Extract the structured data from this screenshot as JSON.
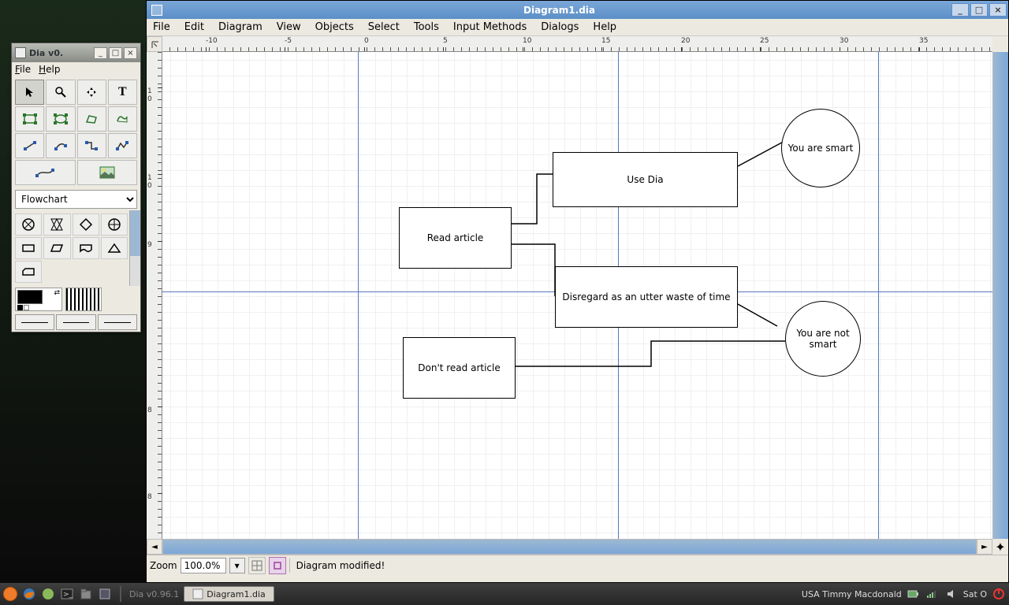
{
  "toolbox": {
    "title": "Dia v0.",
    "menu": {
      "file": "File",
      "help": "Help"
    },
    "shape_category": "Flowchart"
  },
  "main": {
    "title": "Diagram1.dia",
    "menu": {
      "file": "File",
      "edit": "Edit",
      "diagram": "Diagram",
      "view": "View",
      "objects": "Objects",
      "select": "Select",
      "tools": "Tools",
      "input_methods": "Input Methods",
      "dialogs": "Dialogs",
      "help": "Help"
    },
    "ruler_h": [
      "-10",
      "-5",
      "0",
      "5",
      "10",
      "15",
      "20",
      "25",
      "30",
      "35"
    ],
    "ruler_v": [
      "10",
      "9",
      "8",
      "8"
    ],
    "shapes": {
      "use_dia": "Use Dia",
      "read_article": "Read article",
      "disregard": "Disregard as an utter waste of time",
      "dont_read": "Don't read article",
      "smart": "You are smart",
      "not_smart": "You are not smart"
    },
    "zoom_label": "Zoom",
    "zoom_value": "100.0%",
    "status_text": "Diagram modified!"
  },
  "taskbar": {
    "app1": "Dia v0.96.1",
    "app2": "Diagram1.dia",
    "user": "USA  Timmy Macdonald",
    "time": "Sat O"
  }
}
